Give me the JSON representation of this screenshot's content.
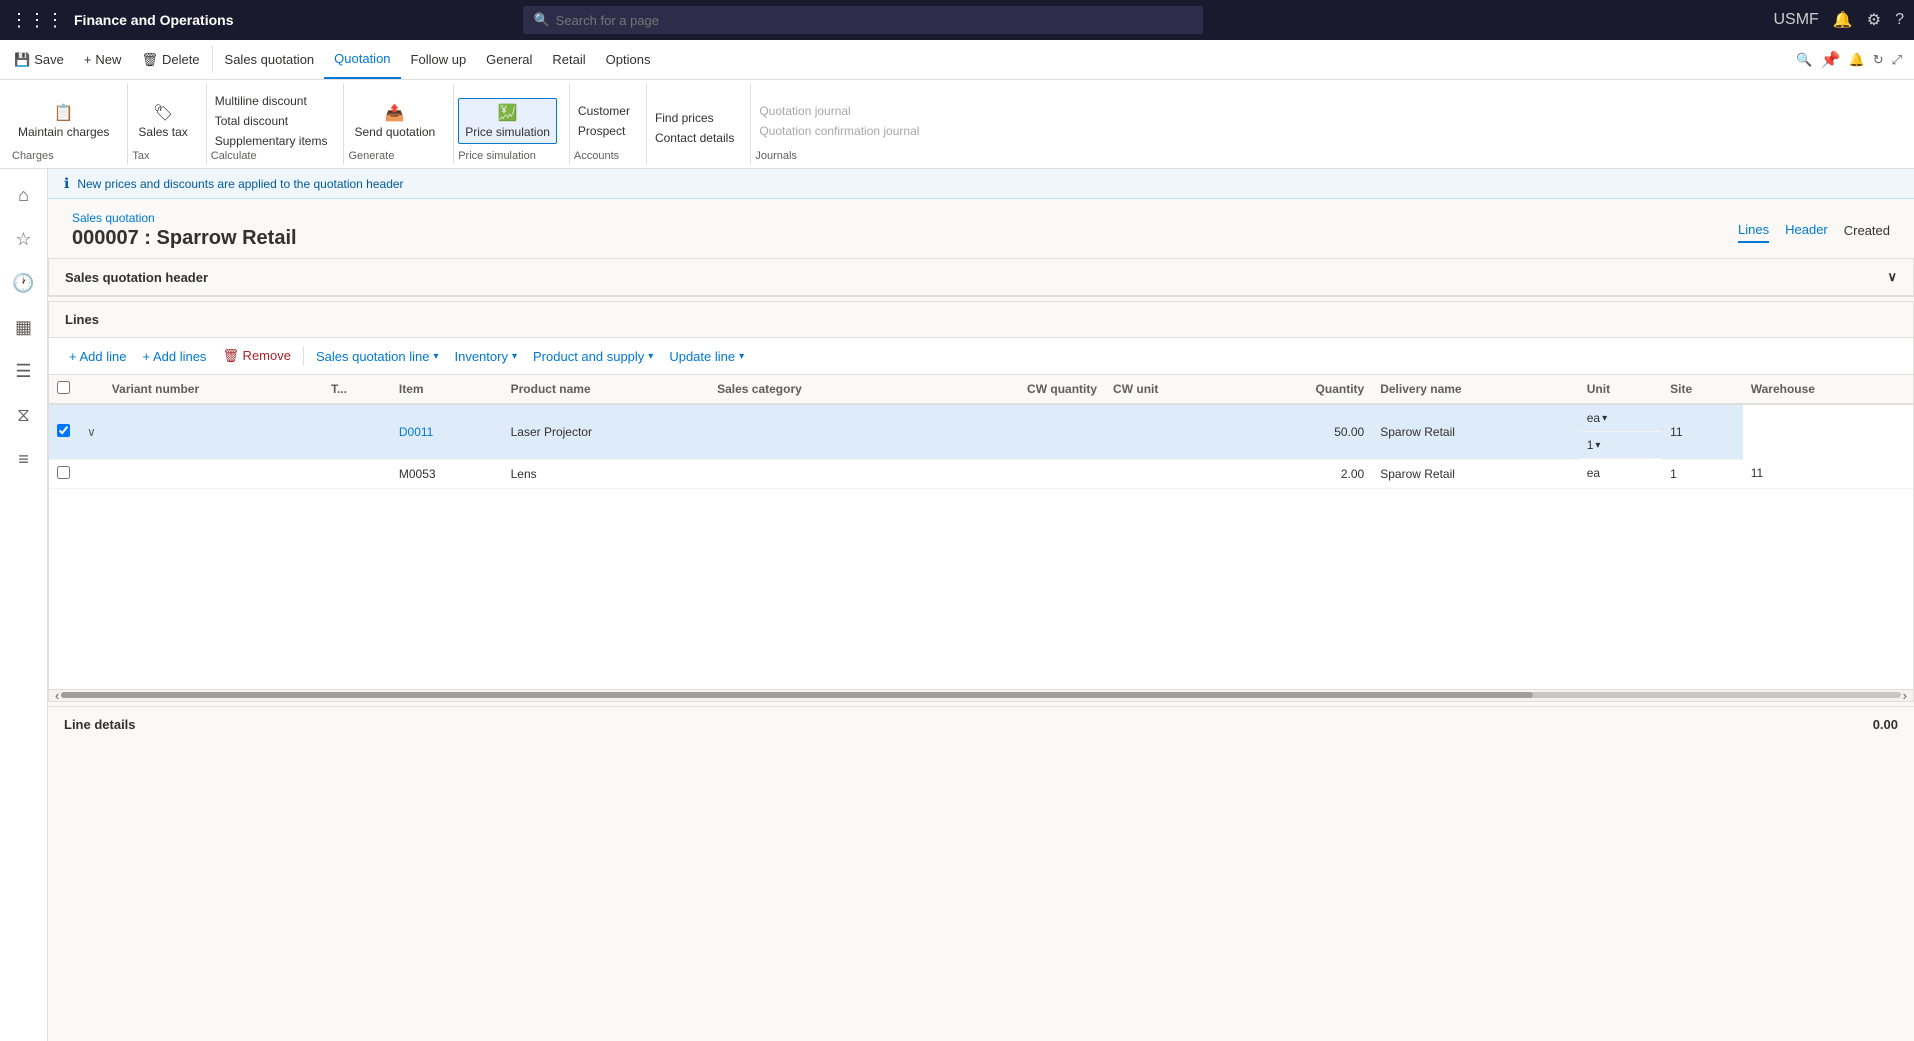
{
  "app": {
    "title": "Finance and Operations",
    "user": "USMF",
    "search_placeholder": "Search for a page"
  },
  "ribbon_tabs": [
    {
      "label": "Save",
      "icon": "💾"
    },
    {
      "label": "New",
      "icon": "+"
    },
    {
      "label": "Delete",
      "icon": "🗑"
    },
    {
      "label": "Sales quotation"
    },
    {
      "label": "Quotation",
      "active": true
    },
    {
      "label": "Follow up"
    },
    {
      "label": "General"
    },
    {
      "label": "Retail"
    },
    {
      "label": "Options"
    }
  ],
  "toolbar": {
    "groups": [
      {
        "label": "Charges",
        "items": [
          {
            "label": "Maintain charges"
          }
        ]
      },
      {
        "label": "Tax",
        "items": [
          {
            "label": "Sales tax"
          }
        ]
      },
      {
        "label": "Calculate",
        "items": [
          {
            "label": "Multiline discount"
          },
          {
            "label": "Total discount"
          },
          {
            "label": "Supplementary items"
          }
        ]
      },
      {
        "label": "Generate",
        "items": [
          {
            "label": "Send quotation"
          }
        ]
      },
      {
        "label": "Price simulation",
        "items": [
          {
            "label": "Price simulation",
            "active": true
          }
        ]
      },
      {
        "label": "Accounts",
        "items": [
          {
            "label": "Customer"
          },
          {
            "label": "Prospect"
          }
        ]
      },
      {
        "label": "Accounts",
        "items": [
          {
            "label": "Find prices"
          },
          {
            "label": "Contact details"
          }
        ]
      },
      {
        "label": "Journals",
        "items": [
          {
            "label": "Quotation journal"
          },
          {
            "label": "Quotation confirmation journal"
          }
        ]
      }
    ]
  },
  "info_bar": {
    "message": "New prices and discounts are applied to the quotation header"
  },
  "page": {
    "breadcrumb": "Sales quotation",
    "title": "000007 : Sparrow Retail",
    "tabs": [
      {
        "label": "Lines",
        "active": true
      },
      {
        "label": "Header"
      },
      {
        "label": "Created"
      }
    ]
  },
  "sections": {
    "header": "Sales quotation header",
    "lines": "Lines"
  },
  "lines_toolbar": [
    {
      "label": "+ Add line"
    },
    {
      "label": "+ Add lines"
    },
    {
      "label": "🗑 Remove"
    },
    {
      "label": "Sales quotation line",
      "dropdown": true
    },
    {
      "label": "Inventory",
      "dropdown": true
    },
    {
      "label": "Product and supply",
      "dropdown": true
    },
    {
      "label": "Update line",
      "dropdown": true
    }
  ],
  "table": {
    "columns": [
      {
        "key": "checkbox",
        "label": ""
      },
      {
        "key": "expand",
        "label": ""
      },
      {
        "key": "variant_number",
        "label": "Variant number"
      },
      {
        "key": "t",
        "label": "T..."
      },
      {
        "key": "item",
        "label": "Item"
      },
      {
        "key": "product_name",
        "label": "Product name"
      },
      {
        "key": "sales_category",
        "label": "Sales category"
      },
      {
        "key": "cw_quantity",
        "label": "CW quantity"
      },
      {
        "key": "cw_unit",
        "label": "CW unit"
      },
      {
        "key": "quantity",
        "label": "Quantity"
      },
      {
        "key": "delivery_name",
        "label": "Delivery name"
      },
      {
        "key": "unit",
        "label": "Unit"
      },
      {
        "key": "site",
        "label": "Site"
      },
      {
        "key": "warehouse",
        "label": "Warehouse"
      }
    ],
    "rows": [
      {
        "selected": true,
        "variant_number": "",
        "t": "",
        "item": "D0011",
        "item_link": true,
        "product_name": "Laser Projector",
        "sales_category": "",
        "cw_quantity": "",
        "cw_unit": "",
        "quantity": "50.00",
        "delivery_name": "Sparow Retail",
        "unit": "ea",
        "site": "1",
        "warehouse": "11"
      },
      {
        "selected": false,
        "variant_number": "",
        "t": "",
        "item": "M0053",
        "item_link": false,
        "product_name": "Lens",
        "sales_category": "",
        "cw_quantity": "",
        "cw_unit": "",
        "quantity": "2.00",
        "delivery_name": "Sparow Retail",
        "unit": "ea",
        "site": "1",
        "warehouse": "11"
      }
    ]
  },
  "line_details": {
    "label": "Line details",
    "value": "0.00"
  }
}
